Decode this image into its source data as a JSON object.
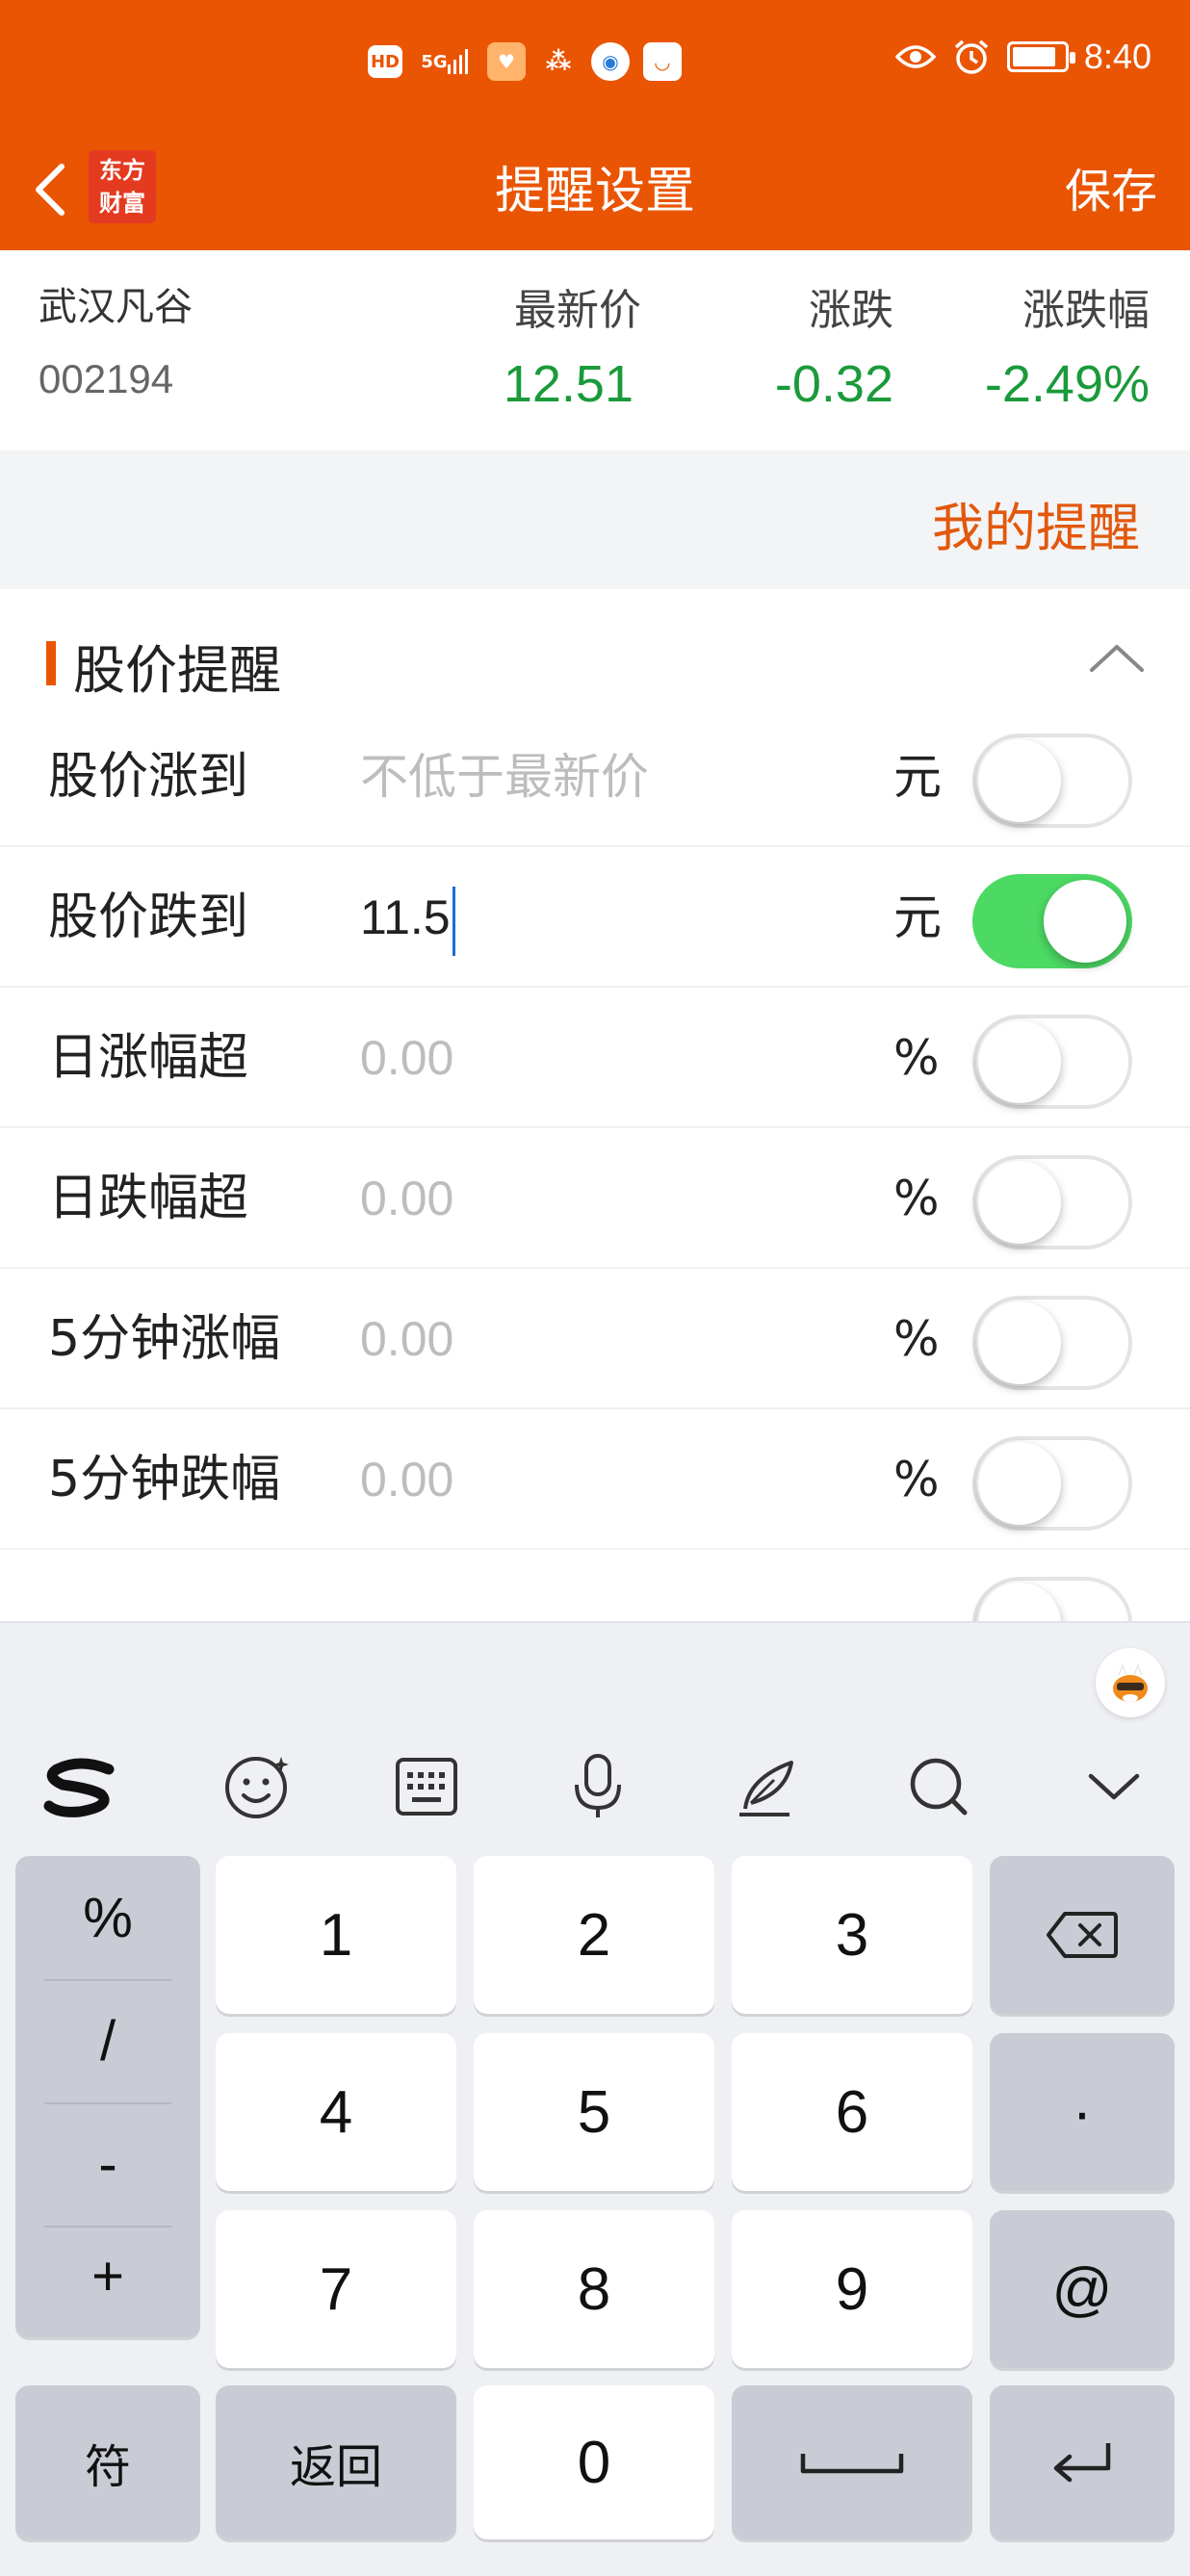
{
  "status_bar": {
    "hd": "HD",
    "signal": "5G",
    "time": "8:40",
    "battery_level": 0.85
  },
  "header": {
    "logo_text": "东方财富",
    "title": "提醒设置",
    "save_label": "保存"
  },
  "quote": {
    "name": "武汉凡谷",
    "code": "002194",
    "headers": [
      "最新价",
      "涨跌",
      "涨跌幅"
    ],
    "values": [
      "12.51",
      "-0.32",
      "-2.49%"
    ],
    "value_color": "#1a9a3a"
  },
  "my_reminders_label": "我的提醒",
  "section": {
    "title": "股价提醒",
    "rows": [
      {
        "label": "股价涨到",
        "value": "",
        "placeholder": "不低于最新价",
        "unit": "元",
        "enabled": false
      },
      {
        "label": "股价跌到",
        "value": "11.5",
        "placeholder": "",
        "unit": "元",
        "enabled": true
      },
      {
        "label": "日涨幅超",
        "value": "",
        "placeholder": "0.00",
        "unit": "%",
        "enabled": false
      },
      {
        "label": "日跌幅超",
        "value": "",
        "placeholder": "0.00",
        "unit": "%",
        "enabled": false
      },
      {
        "label": "5分钟涨幅",
        "value": "",
        "placeholder": "0.00",
        "unit": "%",
        "enabled": false
      },
      {
        "label": "5分钟跌幅",
        "value": "",
        "placeholder": "0.00",
        "unit": "%",
        "enabled": false
      }
    ]
  },
  "keyboard": {
    "symbols": [
      "%",
      "/",
      "-",
      "+"
    ],
    "digits": [
      "1",
      "2",
      "3",
      "4",
      "5",
      "6",
      "7",
      "8",
      "9",
      "0"
    ],
    "dot": "·",
    "at": "@",
    "fu": "符",
    "back": "返回"
  },
  "colors": {
    "brand": "#ea5504",
    "toggle_on": "#4cd964",
    "down": "#1a9a3a"
  }
}
